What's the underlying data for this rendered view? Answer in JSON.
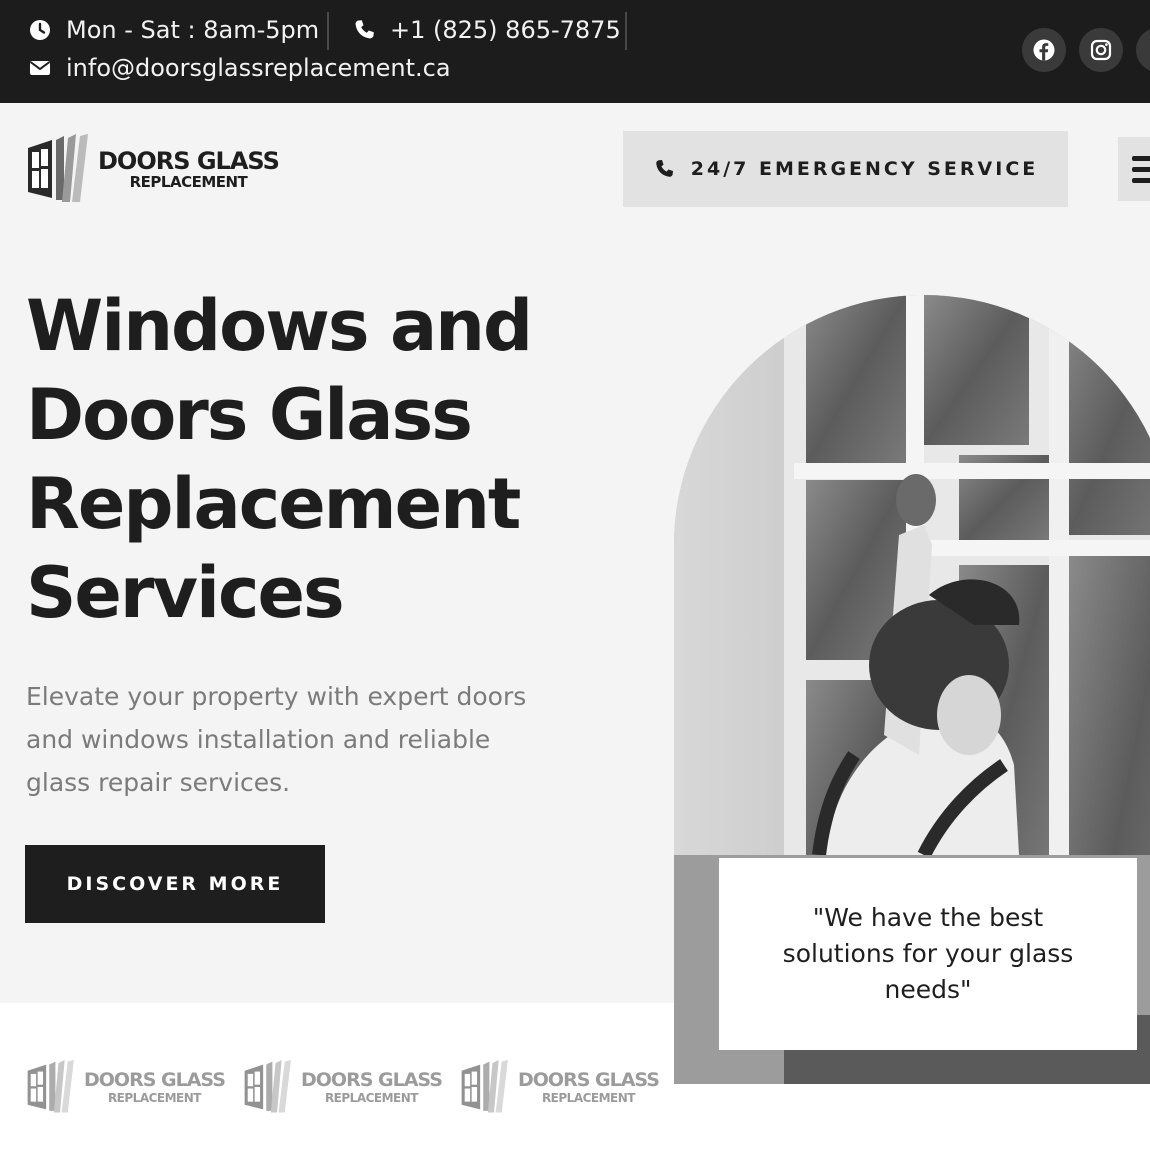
{
  "topbar": {
    "hours": "Mon - Sat : 8am-5pm",
    "phone": "+1 (825) 865-7875",
    "email": "info@doorsglassreplacement.ca",
    "icons": {
      "hours": "clock-icon",
      "phone": "phone-icon",
      "email": "envelope-icon"
    },
    "social": [
      "facebook-icon",
      "instagram-icon",
      "social-icon"
    ]
  },
  "header": {
    "logo": {
      "line1": "DOORS GLASS",
      "line2": "REPLACEMENT"
    },
    "emergency_label": "24/7 EMERGENCY SERVICE",
    "menu_icon": "hamburger-icon"
  },
  "hero": {
    "title_lines": [
      "Windows and",
      "Doors Glass",
      "Replacement",
      "Services"
    ],
    "subtitle_lines": [
      "Elevate your property with expert doors",
      "and windows installation and reliable",
      "glass repair services."
    ],
    "cta_label": "DISCOVER MORE",
    "quote_lines": [
      "\"We have the best",
      "solutions for your glass",
      "needs\""
    ]
  },
  "partners": [
    {
      "line1": "DOORS GLASS",
      "line2": "REPLACEMENT"
    },
    {
      "line1": "DOORS GLASS",
      "line2": "REPLACEMENT"
    },
    {
      "line1": "DOORS GLASS",
      "line2": "REPLACEMENT"
    }
  ],
  "colors": {
    "dark": "#1c1c1c",
    "light_bg": "#f4f4f4",
    "button_grey": "#e2e2e2",
    "muted_text": "#7b7b7b"
  }
}
